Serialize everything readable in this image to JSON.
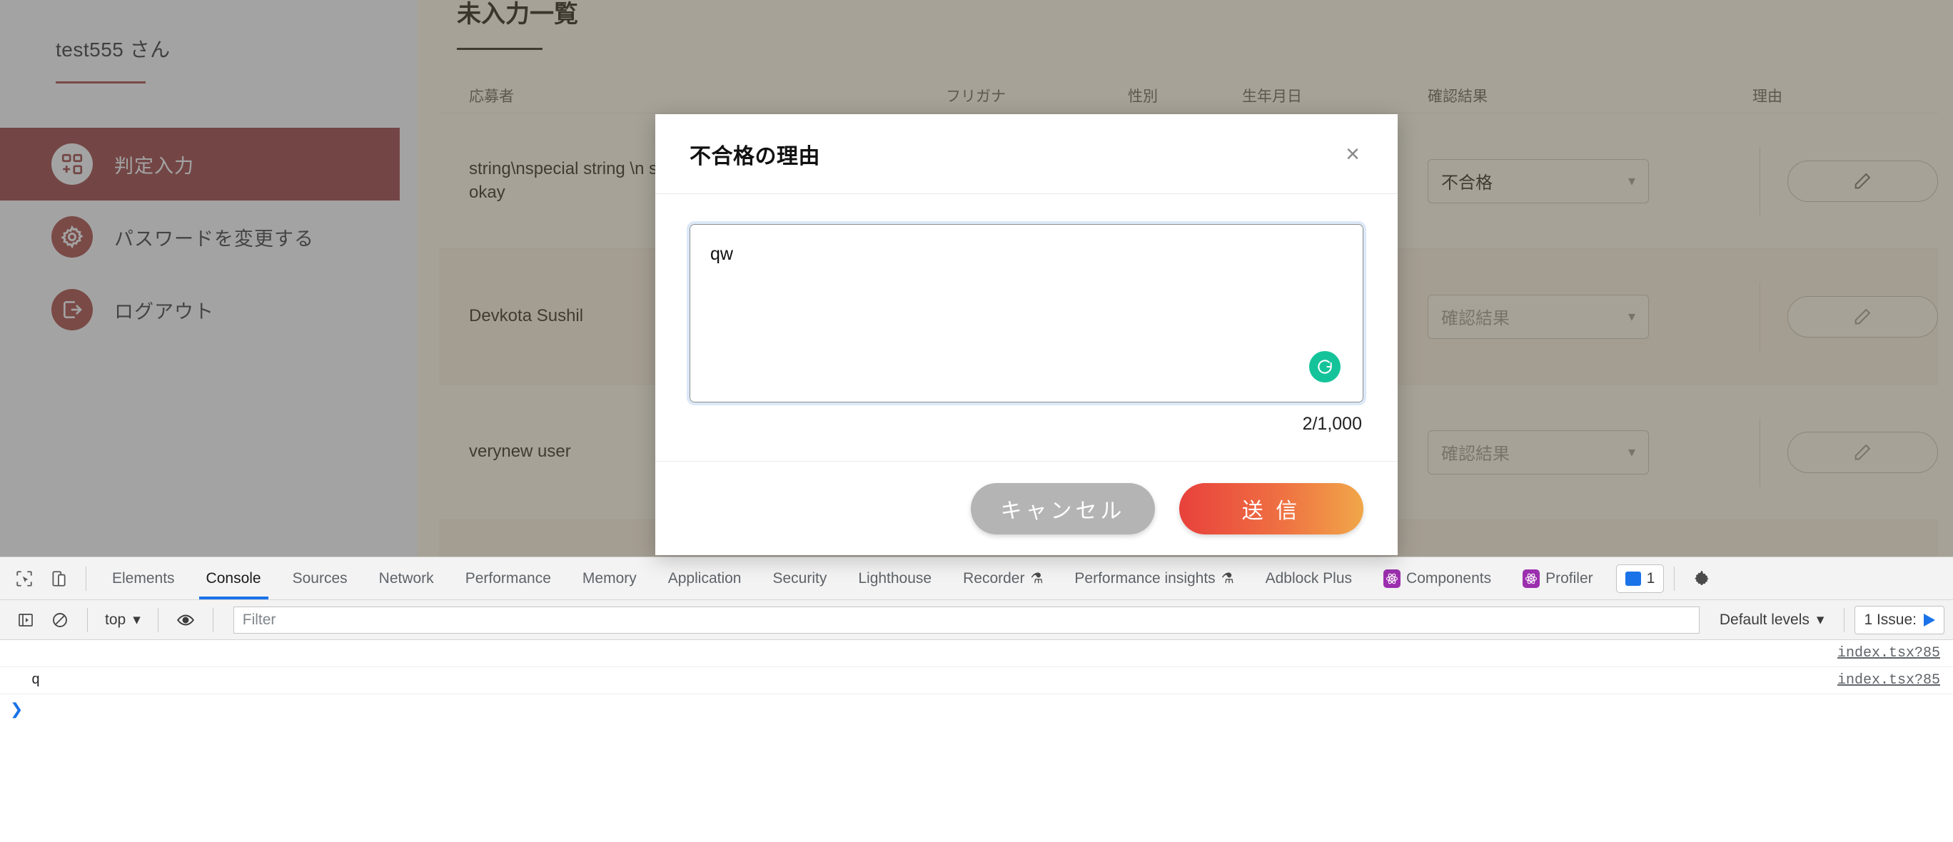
{
  "app": {
    "sidebar": {
      "user_name": "test555 さん",
      "items": [
        {
          "label": "判定入力",
          "icon": "grid-plus-icon",
          "active": true
        },
        {
          "label": "パスワードを変更する",
          "icon": "gear-icon",
          "active": false
        },
        {
          "label": "ログアウト",
          "icon": "logout-icon",
          "active": false
        }
      ]
    },
    "main": {
      "page_title": "未入力一覧",
      "table": {
        "headers": [
          "応募者",
          "フリガナ",
          "性別",
          "生年月日",
          "確認結果",
          "理由"
        ],
        "rows": [
          {
            "applicant": "string\\nspecial string \\n string",
            "applicant_line2": "okay",
            "furigana": "",
            "gender": "",
            "birthdate": "",
            "result": "不合格",
            "result_is_placeholder": false,
            "reason_button": "edit-pencil-icon"
          },
          {
            "applicant": "Devkota Sushil",
            "applicant_line2": "",
            "furigana": "",
            "gender": "",
            "birthdate": "",
            "result": "確認結果",
            "result_is_placeholder": true,
            "reason_button": "edit-pencil-icon"
          },
          {
            "applicant": "verynew user",
            "applicant_line2": "",
            "furigana": "",
            "gender": "",
            "birthdate": "",
            "result": "確認結果",
            "result_is_placeholder": true,
            "reason_button": "edit-pencil-icon"
          }
        ]
      }
    }
  },
  "modal": {
    "title": "不合格の理由",
    "close_label": "×",
    "textarea_value": "qw",
    "textarea_placeholder": "",
    "counter": "2/1,000",
    "grammarly_label": "G",
    "cancel_label": "キャンセル",
    "submit_label": "送 信"
  },
  "devtools": {
    "tabs": [
      {
        "label": "Elements",
        "active": false,
        "icon": null
      },
      {
        "label": "Console",
        "active": true,
        "icon": null
      },
      {
        "label": "Sources",
        "active": false,
        "icon": null
      },
      {
        "label": "Network",
        "active": false,
        "icon": null
      },
      {
        "label": "Performance",
        "active": false,
        "icon": null
      },
      {
        "label": "Memory",
        "active": false,
        "icon": null
      },
      {
        "label": "Application",
        "active": false,
        "icon": null
      },
      {
        "label": "Security",
        "active": false,
        "icon": null
      },
      {
        "label": "Lighthouse",
        "active": false,
        "icon": null
      },
      {
        "label": "Recorder",
        "active": false,
        "icon": "flask-icon"
      },
      {
        "label": "Performance insights",
        "active": false,
        "icon": "flask-icon"
      },
      {
        "label": "Adblock Plus",
        "active": false,
        "icon": null
      },
      {
        "label": "Components",
        "active": false,
        "icon": "react-icon"
      },
      {
        "label": "Profiler",
        "active": false,
        "icon": "react-icon"
      }
    ],
    "message_count": "1",
    "filterbar": {
      "context": "top",
      "filter_placeholder": "Filter",
      "levels": "Default levels",
      "issues": "1 Issue:"
    },
    "logs": [
      {
        "message": "",
        "source": "index.tsx?85"
      },
      {
        "message": "q",
        "source": "index.tsx?85"
      }
    ],
    "prompt": "❯"
  }
}
